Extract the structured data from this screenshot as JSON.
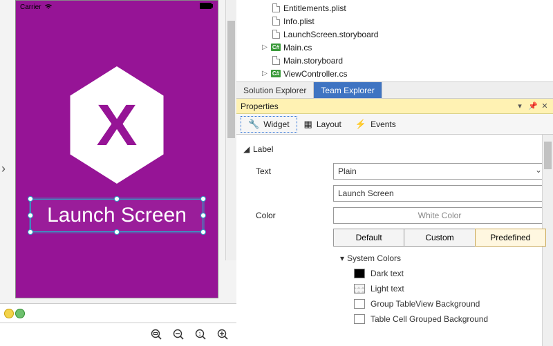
{
  "phone": {
    "carrier": "Carrier",
    "wifi_icon": "wifi-icon",
    "battery_icon": "battery-icon",
    "logo_letter": "X",
    "launch_label": "Launch Screen"
  },
  "tree": {
    "items": [
      {
        "expand": "",
        "icon": "doc",
        "label": "Entitlements.plist"
      },
      {
        "expand": "",
        "icon": "doc",
        "label": "Info.plist"
      },
      {
        "expand": "",
        "icon": "doc",
        "label": "LaunchScreen.storyboard"
      },
      {
        "expand": "▷",
        "icon": "cs",
        "label": "Main.cs"
      },
      {
        "expand": "",
        "icon": "doc",
        "label": "Main.storyboard"
      },
      {
        "expand": "▷",
        "icon": "cs",
        "label": "ViewController.cs"
      }
    ]
  },
  "panel_tabs": {
    "a": "Solution Explorer",
    "b": "Team Explorer"
  },
  "props_panel": {
    "title": "Properties",
    "tabs": {
      "widget": "Widget",
      "layout": "Layout",
      "events": "Events"
    },
    "section": "Label",
    "text_label": "Text",
    "text_type": "Plain",
    "text_value": "Launch Screen",
    "color_label": "Color",
    "color_value": "White Color",
    "seg": {
      "a": "Default",
      "b": "Custom",
      "c": "Predefined"
    },
    "syscolors_header": "System Colors",
    "syscolors": [
      "Dark text",
      "Light text",
      "Group TableView Background",
      "Table Cell Grouped Background"
    ]
  },
  "zoom_icons": [
    "zoom-fit",
    "zoom-out",
    "zoom-100",
    "zoom-in"
  ]
}
